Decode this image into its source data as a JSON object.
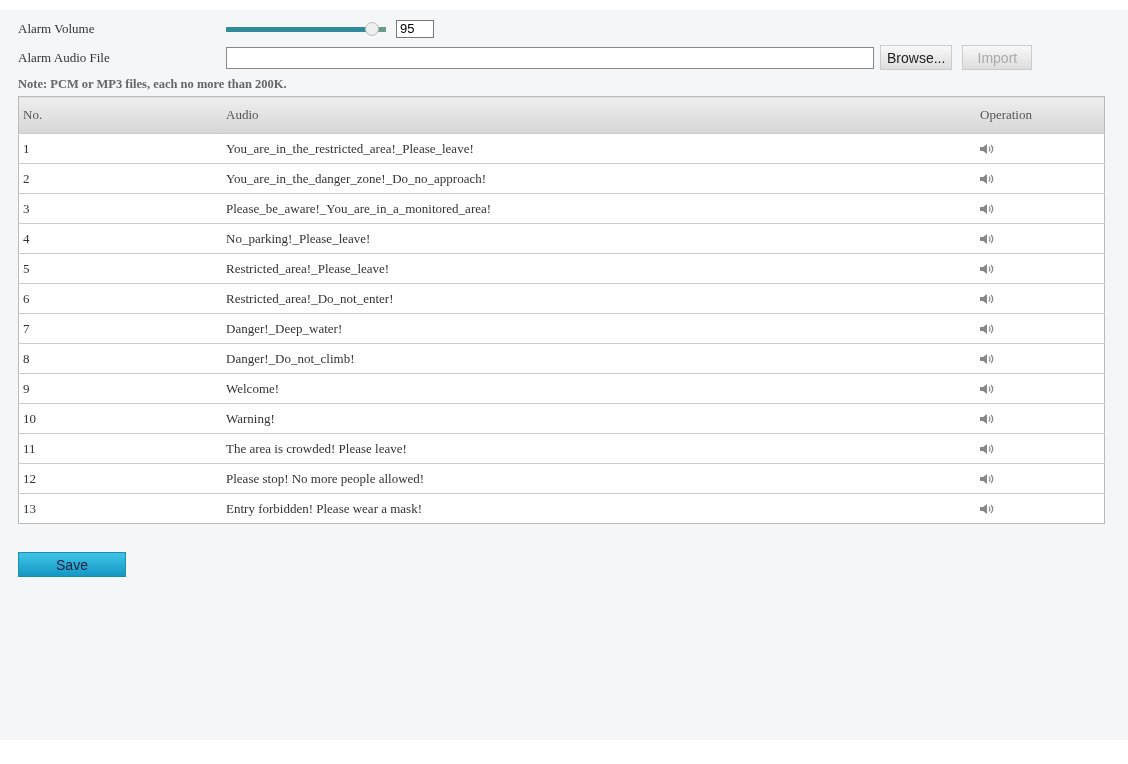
{
  "alarm_volume": {
    "label": "Alarm Volume",
    "level": 0.95,
    "value": "95"
  },
  "alarm_audio_file": {
    "label": "Alarm Audio File",
    "browse_button": "Browse...",
    "import_button": {
      "label": "Import",
      "disabled": true
    }
  },
  "note": "Note: PCM or MP3 files, each no more than 200K.",
  "table": {
    "columns": [
      "No.",
      "Audio",
      "Operation"
    ],
    "rows": [
      {
        "no": "1",
        "audio": "You_are_in_the_restricted_area!_Please_leave!"
      },
      {
        "no": "2",
        "audio": "You_are_in_the_danger_zone!_Do_no_approach!"
      },
      {
        "no": "3",
        "audio": "Please_be_aware!_You_are_in_a_monitored_area!"
      },
      {
        "no": "4",
        "audio": "No_parking!_Please_leave!"
      },
      {
        "no": "5",
        "audio": "Restricted_area!_Please_leave!"
      },
      {
        "no": "6",
        "audio": "Restricted_area!_Do_not_enter!"
      },
      {
        "no": "7",
        "audio": "Danger!_Deep_water!"
      },
      {
        "no": "8",
        "audio": "Danger!_Do_not_climb!"
      },
      {
        "no": "9",
        "audio": "Welcome!"
      },
      {
        "no": "10",
        "audio": "Warning!"
      },
      {
        "no": "11",
        "audio": "The area is crowded! Please leave!"
      },
      {
        "no": "12",
        "audio": "Please stop! No more people allowed!"
      },
      {
        "no": "13",
        "audio": "Entry forbidden! Please wear a mask!"
      }
    ]
  },
  "save_button": "Save"
}
